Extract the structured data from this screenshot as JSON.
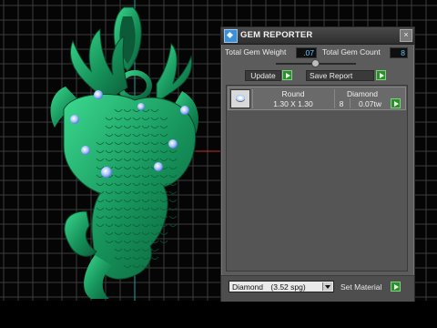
{
  "window": {
    "title": "GEM REPORTER",
    "close_glyph": "×"
  },
  "summary": {
    "weight_label": "Total Gem Weight",
    "weight_value": ".07",
    "count_label": "Total Gem Count",
    "count_value": "8"
  },
  "actions": {
    "update_label": "Update",
    "save_report_label": "Save Report"
  },
  "gem_list": {
    "columns": [
      "Round",
      "Diamond"
    ],
    "rows": [
      {
        "icon": "round-gem-icon",
        "size": "1.30 X 1.30",
        "count": "8",
        "weight": "0.07tw"
      }
    ]
  },
  "material": {
    "name": "Diamond",
    "density": "(3.52 spg)",
    "set_label": "Set Material"
  },
  "colors": {
    "panel_bg": "#5c5c5c",
    "model_green": "#1aa86b",
    "gem_blue": "#7fa8ff",
    "value_text": "#5fc8ff",
    "play_green": "#2f8f2f"
  }
}
